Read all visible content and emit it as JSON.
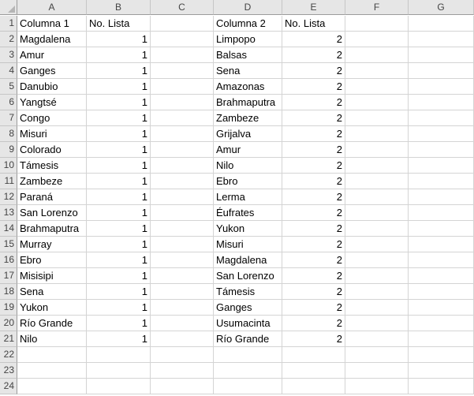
{
  "columns": [
    "A",
    "B",
    "C",
    "D",
    "E",
    "F",
    "G"
  ],
  "rows": [
    [
      "Columna 1",
      "No. Lista",
      "",
      "Columna 2",
      "No. Lista",
      "",
      ""
    ],
    [
      "Magdalena",
      "1",
      "",
      "Limpopo",
      "2",
      "",
      ""
    ],
    [
      "Amur",
      "1",
      "",
      "Balsas",
      "2",
      "",
      ""
    ],
    [
      "Ganges",
      "1",
      "",
      "Sena",
      "2",
      "",
      ""
    ],
    [
      "Danubio",
      "1",
      "",
      "Amazonas",
      "2",
      "",
      ""
    ],
    [
      "Yangtsé",
      "1",
      "",
      "Brahmaputra",
      "2",
      "",
      ""
    ],
    [
      "Congo",
      "1",
      "",
      "Zambeze",
      "2",
      "",
      ""
    ],
    [
      "Misuri",
      "1",
      "",
      "Grijalva",
      "2",
      "",
      ""
    ],
    [
      "Colorado",
      "1",
      "",
      "Amur",
      "2",
      "",
      ""
    ],
    [
      "Támesis",
      "1",
      "",
      "Nilo",
      "2",
      "",
      ""
    ],
    [
      "Zambeze",
      "1",
      "",
      "Ebro",
      "2",
      "",
      ""
    ],
    [
      "Paraná",
      "1",
      "",
      "Lerma",
      "2",
      "",
      ""
    ],
    [
      "San Lorenzo",
      "1",
      "",
      "Éufrates",
      "2",
      "",
      ""
    ],
    [
      "Brahmaputra",
      "1",
      "",
      "Yukon",
      "2",
      "",
      ""
    ],
    [
      "Murray",
      "1",
      "",
      "Misuri",
      "2",
      "",
      ""
    ],
    [
      "Ebro",
      "1",
      "",
      "Magdalena",
      "2",
      "",
      ""
    ],
    [
      "Misisipi",
      "1",
      "",
      "San Lorenzo",
      "2",
      "",
      ""
    ],
    [
      "Sena",
      "1",
      "",
      "Támesis",
      "2",
      "",
      ""
    ],
    [
      "Yukon",
      "1",
      "",
      "Ganges",
      "2",
      "",
      ""
    ],
    [
      "Río Grande",
      "1",
      "",
      "Usumacinta",
      "2",
      "",
      ""
    ],
    [
      "Nilo",
      "1",
      "",
      "Río Grande",
      "2",
      "",
      ""
    ],
    [
      "",
      "",
      "",
      "",
      "",
      "",
      ""
    ],
    [
      "",
      "",
      "",
      "",
      "",
      "",
      ""
    ],
    [
      "",
      "",
      "",
      "",
      "",
      "",
      ""
    ]
  ]
}
